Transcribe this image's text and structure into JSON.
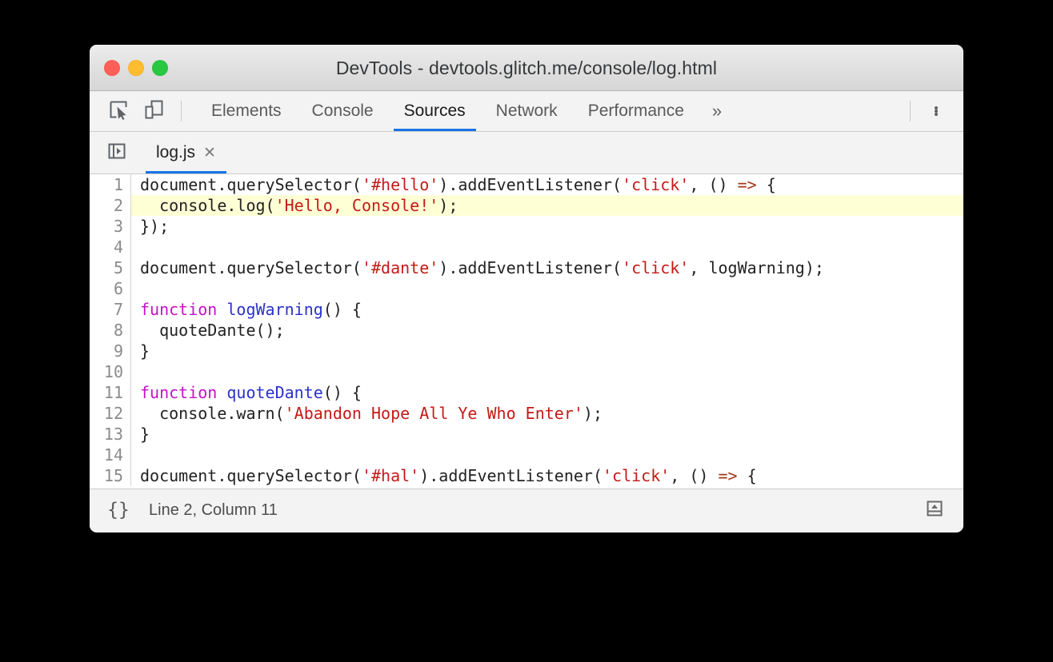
{
  "window": {
    "title": "DevTools - devtools.glitch.me/console/log.html",
    "traffic_lights": [
      {
        "name": "close",
        "color": "#ff5f57"
      },
      {
        "name": "minimize",
        "color": "#febc2e"
      },
      {
        "name": "maximize",
        "color": "#28c840"
      }
    ]
  },
  "toolbar": {
    "inspect_icon": "inspect-element-icon",
    "device_icon": "device-toolbar-icon",
    "tabs": [
      {
        "label": "Elements",
        "active": false
      },
      {
        "label": "Console",
        "active": false
      },
      {
        "label": "Sources",
        "active": true
      },
      {
        "label": "Network",
        "active": false
      },
      {
        "label": "Performance",
        "active": false
      }
    ],
    "overflow_label": "»",
    "more_menu_icon": "more-vertical-icon",
    "active_tab_underline_color": "#1a73e8"
  },
  "file_tabs": {
    "navigator_toggle_icon": "show-navigator-icon",
    "tabs": [
      {
        "label": "log.js",
        "close_label": "✕",
        "active": true
      }
    ]
  },
  "editor": {
    "highlighted_line": 2,
    "highlight_color": "#ffffd6",
    "syntax_colors": {
      "string": "#c41a16",
      "keyword": "#c313c3",
      "function": "#2b32c8",
      "arrow": "#a3371a",
      "plain": "#222222",
      "line_number": "#8b8b8b"
    },
    "lines": [
      {
        "num": "1",
        "tokens": [
          {
            "t": "document.querySelector(",
            "c": "plain"
          },
          {
            "t": "'#hello'",
            "c": "string"
          },
          {
            "t": ").addEventListener(",
            "c": "plain"
          },
          {
            "t": "'click'",
            "c": "string"
          },
          {
            "t": ", () ",
            "c": "plain"
          },
          {
            "t": "=>",
            "c": "arrow"
          },
          {
            "t": " {",
            "c": "plain"
          }
        ]
      },
      {
        "num": "2",
        "highlight": true,
        "tokens": [
          {
            "t": "  console.log(",
            "c": "plain"
          },
          {
            "t": "'Hello, Console!'",
            "c": "string"
          },
          {
            "t": ");",
            "c": "plain"
          }
        ]
      },
      {
        "num": "3",
        "tokens": [
          {
            "t": "});",
            "c": "plain"
          }
        ]
      },
      {
        "num": "4",
        "tokens": [
          {
            "t": "",
            "c": "plain"
          }
        ]
      },
      {
        "num": "5",
        "tokens": [
          {
            "t": "document.querySelector(",
            "c": "plain"
          },
          {
            "t": "'#dante'",
            "c": "string"
          },
          {
            "t": ").addEventListener(",
            "c": "plain"
          },
          {
            "t": "'click'",
            "c": "string"
          },
          {
            "t": ", logWarning);",
            "c": "plain"
          }
        ]
      },
      {
        "num": "6",
        "tokens": [
          {
            "t": "",
            "c": "plain"
          }
        ]
      },
      {
        "num": "7",
        "tokens": [
          {
            "t": "function",
            "c": "keyword"
          },
          {
            "t": " ",
            "c": "plain"
          },
          {
            "t": "logWarning",
            "c": "function"
          },
          {
            "t": "() {",
            "c": "plain"
          }
        ]
      },
      {
        "num": "8",
        "tokens": [
          {
            "t": "  quoteDante();",
            "c": "plain"
          }
        ]
      },
      {
        "num": "9",
        "tokens": [
          {
            "t": "}",
            "c": "plain"
          }
        ]
      },
      {
        "num": "10",
        "tokens": [
          {
            "t": "",
            "c": "plain"
          }
        ]
      },
      {
        "num": "11",
        "tokens": [
          {
            "t": "function",
            "c": "keyword"
          },
          {
            "t": " ",
            "c": "plain"
          },
          {
            "t": "quoteDante",
            "c": "function"
          },
          {
            "t": "() {",
            "c": "plain"
          }
        ]
      },
      {
        "num": "12",
        "tokens": [
          {
            "t": "  console.warn(",
            "c": "plain"
          },
          {
            "t": "'Abandon Hope All Ye Who Enter'",
            "c": "string"
          },
          {
            "t": ");",
            "c": "plain"
          }
        ]
      },
      {
        "num": "13",
        "tokens": [
          {
            "t": "}",
            "c": "plain"
          }
        ]
      },
      {
        "num": "14",
        "tokens": [
          {
            "t": "",
            "c": "plain"
          }
        ]
      },
      {
        "num": "15",
        "tokens": [
          {
            "t": "document.querySelector(",
            "c": "plain"
          },
          {
            "t": "'#hal'",
            "c": "string"
          },
          {
            "t": ").addEventListener(",
            "c": "plain"
          },
          {
            "t": "'click'",
            "c": "string"
          },
          {
            "t": ", () ",
            "c": "plain"
          },
          {
            "t": "=>",
            "c": "arrow"
          },
          {
            "t": " {",
            "c": "plain"
          }
        ]
      }
    ]
  },
  "statusbar": {
    "pretty_print_label": "{}",
    "cursor_position": "Line 2, Column 11",
    "drawer_icon": "show-drawer-icon"
  }
}
